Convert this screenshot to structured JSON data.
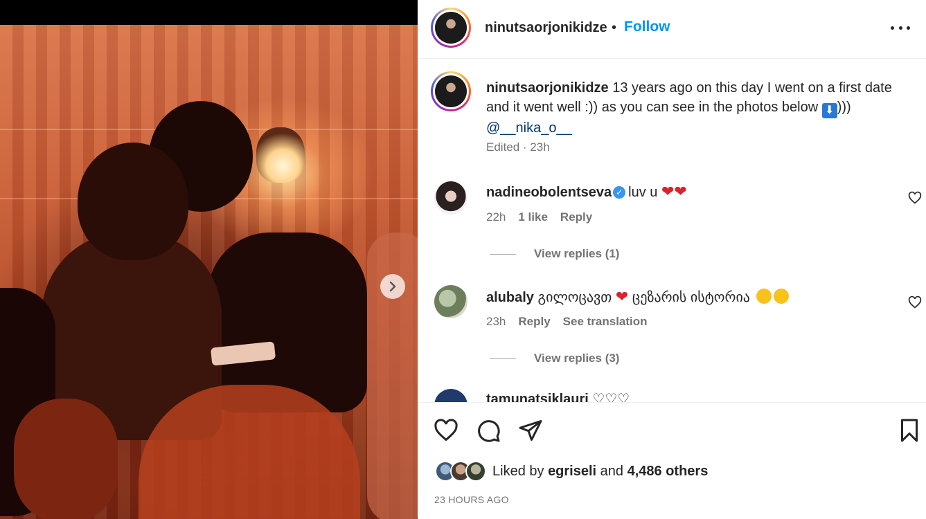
{
  "post": {
    "username": "ninutsaorjonikidze",
    "separator": "•",
    "follow_label": "Follow",
    "more_icon": "more-options-icon"
  },
  "caption": {
    "username": "ninutsaorjonikidze",
    "text_part1": "13 years ago on this day I went on a first date and it went well :)) as you can see in the photos below",
    "arrow_emoji": "⬇",
    "text_part2": ")))",
    "mention": "@__nika_o__",
    "meta": "Edited · 23h"
  },
  "comments": [
    {
      "username": "nadineobolentseva",
      "verified": true,
      "text": "luv u",
      "emojis": "❤❤",
      "time": "22h",
      "likes": "1 like",
      "reply_label": "Reply",
      "view_replies": "View replies (1)"
    },
    {
      "username": "alubaly",
      "verified": false,
      "text": "გილოცავთ",
      "heart": "❤",
      "text2": "ცეზარის ისტორია",
      "time": "23h",
      "reply_label": "Reply",
      "translate_label": "See translation",
      "view_replies": "View replies (3)"
    },
    {
      "username": "tamunatsiklauri",
      "partial_emojis": "♡♡♡"
    }
  ],
  "likes": {
    "prefix": "Liked by",
    "user": "egriseli",
    "and": "and",
    "others": "4,486 others"
  },
  "timestamp": "23 HOURS AGO",
  "colors": {
    "link": "#0095f6",
    "muted": "#737373",
    "text": "#262626",
    "heart": "#e0202a"
  }
}
